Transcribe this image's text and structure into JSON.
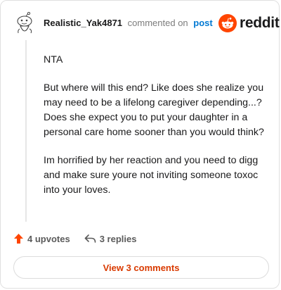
{
  "comment": {
    "username": "Realistic_Yak4871",
    "action_text": "commented on",
    "link_text": "post",
    "paragraphs": [
      "NTA",
      "But where will this end? Like does she realize you may need to be a lifelong caregiver depending...? Does she expect you to put your daughter in a personal care home sooner than you would think?",
      "Im horrified by her reaction and you need to digg and make sure youre not inviting someone toxoc into your loves."
    ]
  },
  "brand": {
    "name": "reddit",
    "color": "#ff4500",
    "icon": "reddit-snoo-icon"
  },
  "actions": {
    "upvotes_label": "4 upvotes",
    "replies_label": "3 replies",
    "upvote_icon": "upvote-arrow-icon",
    "reply_icon": "reply-arrow-icon",
    "upvote_color": "#ff4500"
  },
  "view_comments_label": "View 3 comments"
}
